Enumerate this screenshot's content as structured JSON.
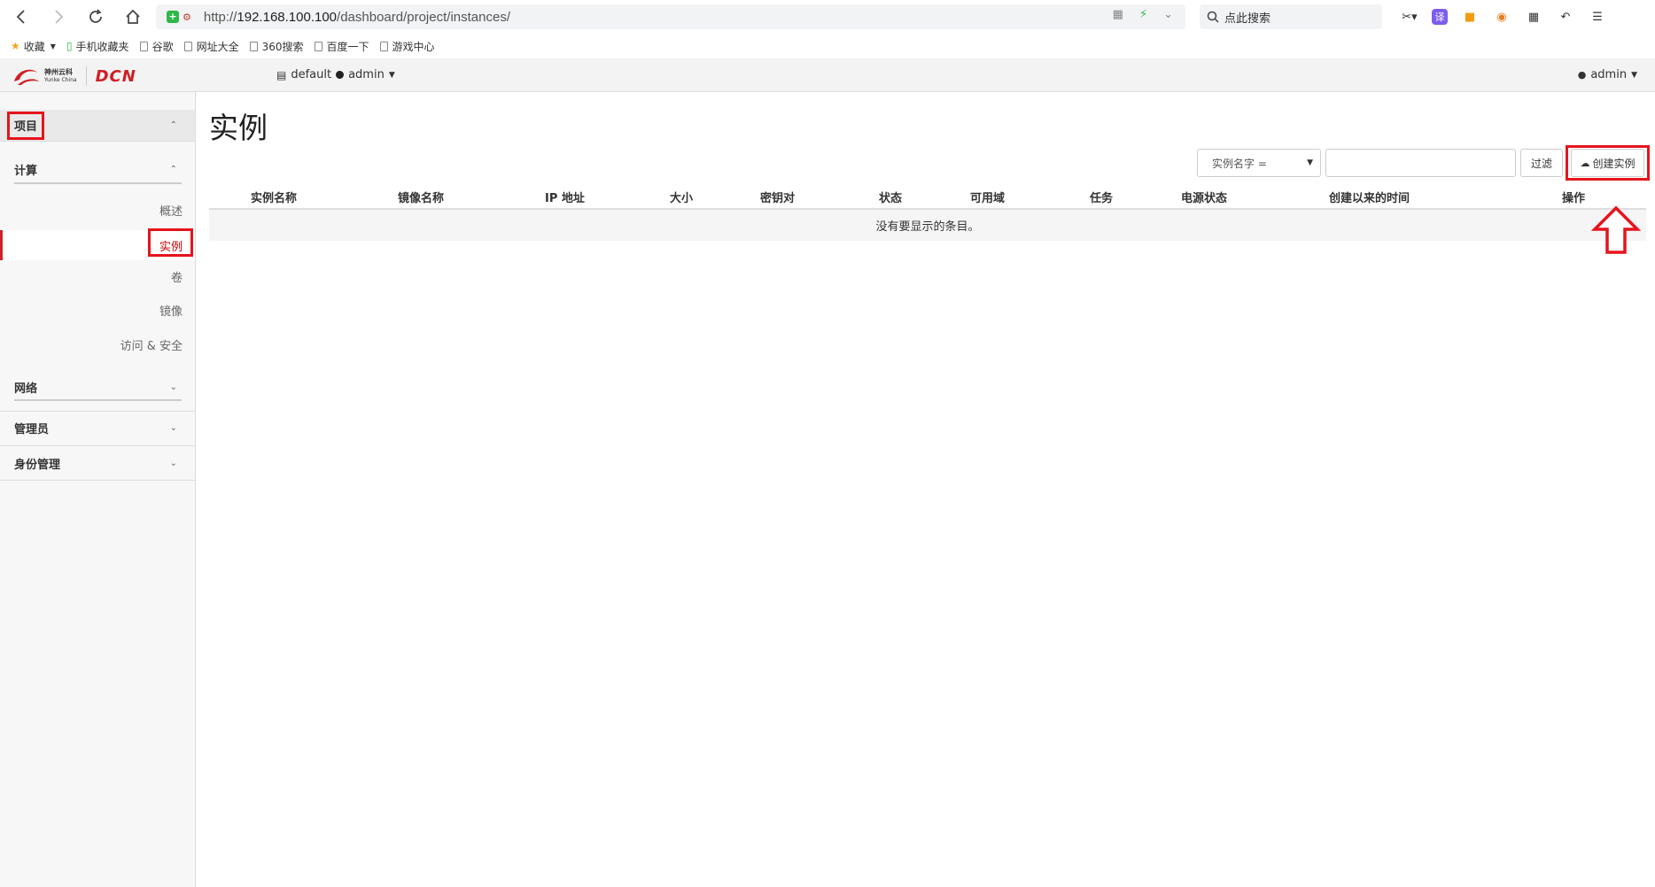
{
  "browser": {
    "url_scheme": "http://",
    "url_host": "192.168.100.100",
    "url_path": "/dashboard/project/instances/",
    "search_placeholder": "点此搜索"
  },
  "bookmarks": [
    {
      "label": "收藏",
      "icon": "star-icon"
    },
    {
      "label": "手机收藏夹",
      "icon": "phone-icon"
    },
    {
      "label": "谷歌",
      "icon": "page-icon"
    },
    {
      "label": "网址大全",
      "icon": "page-icon"
    },
    {
      "label": "360搜索",
      "icon": "page-icon"
    },
    {
      "label": "百度一下",
      "icon": "page-icon"
    },
    {
      "label": "游戏中心",
      "icon": "page-icon"
    }
  ],
  "header": {
    "logo_cn": "神州云科",
    "logo_en": "Yunke China",
    "brand": "DCN",
    "project_domain": "default",
    "project_user": "admin",
    "user": "admin"
  },
  "sidebar": {
    "project": "项目",
    "compute": "计算",
    "compute_items": [
      "概述",
      "实例",
      "卷",
      "镜像",
      "访问 & 安全"
    ],
    "active_item": "实例",
    "network": "网络",
    "admin": "管理员",
    "identity": "身份管理"
  },
  "main": {
    "title": "实例",
    "filter_field": "实例名字 =",
    "filter_value": "",
    "filter_button": "过滤",
    "create_button": "创建实例",
    "columns": [
      "实例名称",
      "镜像名称",
      "IP 地址",
      "大小",
      "密钥对",
      "状态",
      "可用域",
      "任务",
      "电源状态",
      "创建以来的时间",
      "操作"
    ],
    "empty_message": "没有要显示的条目。"
  },
  "colors": {
    "highlight": "#e5141c",
    "brand_red": "#d01f26"
  }
}
